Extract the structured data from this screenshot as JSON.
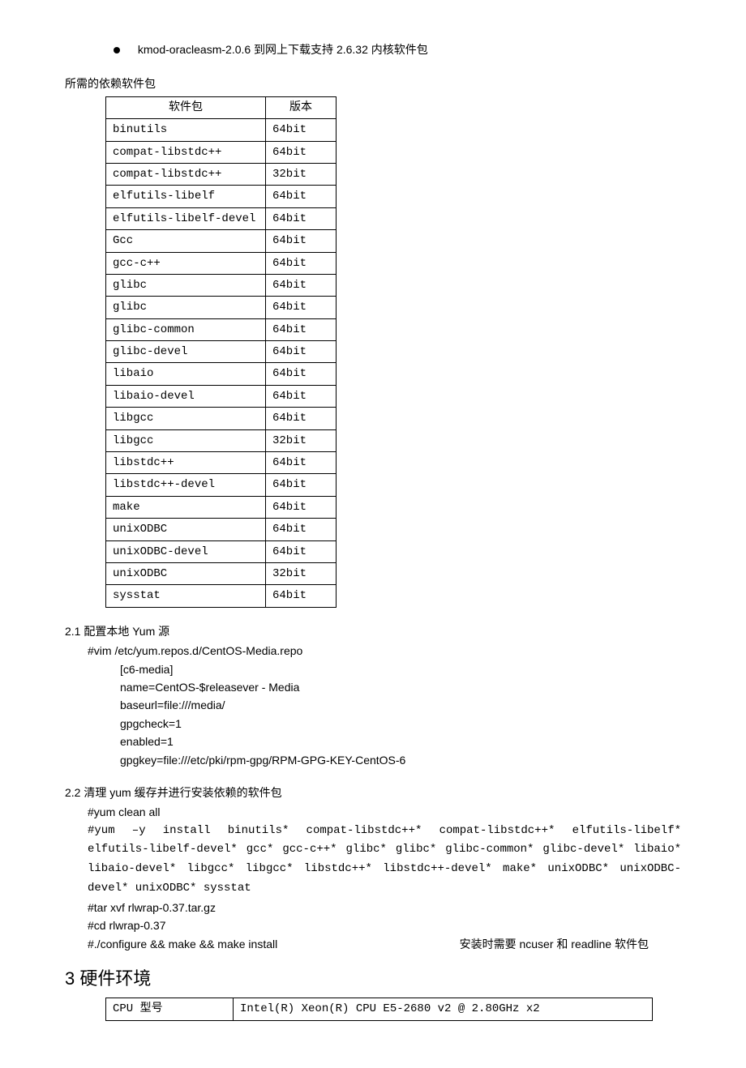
{
  "bullet": {
    "pkg": "kmod-oracleasm-2.0.6",
    "note": "  到网上下载支持 2.6.32 内核软件包"
  },
  "deps_intro": "所需的依赖软件包",
  "table_headers": {
    "pkg": "软件包",
    "ver": "版本"
  },
  "packages": [
    {
      "name": "binutils",
      "ver": "64bit"
    },
    {
      "name": "compat-libstdc++",
      "ver": "64bit"
    },
    {
      "name": "compat-libstdc++",
      "ver": "32bit"
    },
    {
      "name": "elfutils-libelf",
      "ver": "64bit"
    },
    {
      "name": "elfutils-libelf-devel",
      "ver": "64bit"
    },
    {
      "name": "Gcc",
      "ver": "64bit"
    },
    {
      "name": "gcc-c++",
      "ver": "64bit"
    },
    {
      "name": "glibc",
      "ver": "64bit"
    },
    {
      "name": "glibc",
      "ver": "64bit"
    },
    {
      "name": "glibc-common",
      "ver": "64bit"
    },
    {
      "name": "glibc-devel",
      "ver": "64bit"
    },
    {
      "name": "libaio",
      "ver": "64bit"
    },
    {
      "name": "libaio-devel",
      "ver": "64bit"
    },
    {
      "name": "libgcc",
      "ver": "64bit"
    },
    {
      "name": "libgcc",
      "ver": "32bit"
    },
    {
      "name": "libstdc++",
      "ver": "64bit"
    },
    {
      "name": "libstdc++-devel",
      "ver": "64bit"
    },
    {
      "name": "make",
      "ver": "64bit"
    },
    {
      "name": "unixODBC",
      "ver": "64bit"
    },
    {
      "name": "unixODBC-devel",
      "ver": "64bit"
    },
    {
      "name": "unixODBC",
      "ver": "32bit"
    },
    {
      "name": "sysstat",
      "ver": "64bit"
    }
  ],
  "s21": {
    "title": "2.1    配置本地 Yum 源",
    "cmd": "#vim /etc/yum.repos.d/CentOS-Media.repo",
    "lines": [
      "[c6-media]",
      "name=CentOS-$releasever - Media",
      "baseurl=file:///media/",
      "gpgcheck=1",
      "enabled=1",
      "gpgkey=file:///etc/pki/rpm-gpg/RPM-GPG-KEY-CentOS-6"
    ]
  },
  "s22": {
    "title": "2.2    清理 yum 缓存并进行安装依赖的软件包",
    "clean": "#yum clean all",
    "install": "#yum –y install binutils* compat-libstdc++* compat-libstdc++* elfutils-libelf* elfutils-libelf-devel* gcc* gcc-c++* glibc* glibc* glibc-common* glibc-devel* libaio* libaio-devel* libgcc* libgcc* libstdc++* libstdc++-devel* make* unixODBC* unixODBC-devel* unixODBC* sysstat",
    "tar": "#tar xvf rlwrap-0.37.tar.gz",
    "cd": "#cd rlwrap-0.37",
    "configure": "#./configure && make && make install",
    "configure_note": "安装时需要 ncuser 和 readline 软件包"
  },
  "s3": {
    "title": "3   硬件环境",
    "rows": [
      {
        "label": "CPU 型号",
        "value": "Intel(R) Xeon(R) CPU E5-2680 v2 @ 2.80GHz x2"
      }
    ]
  }
}
